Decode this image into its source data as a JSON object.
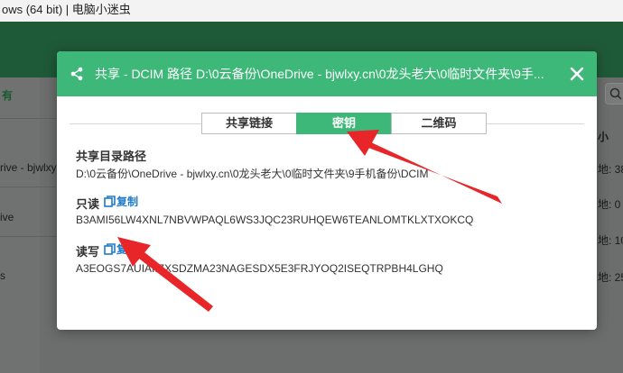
{
  "window": {
    "title": "ows (64 bit) | 电脑小迷虫"
  },
  "background": {
    "col_header": "有",
    "row1": "rive - bjwlxy",
    "row2": "ive",
    "row3": "s",
    "right_header": "小",
    "right_rows": [
      "地: 38",
      "地: 0",
      "地: 10",
      "地: 25"
    ]
  },
  "dialog": {
    "title": "共享 - DCIM 路径 D:\\0云备份\\OneDrive - bjwlxy.cn\\0龙头老大\\0临时文件夹\\9手...",
    "tabs": [
      "共享链接",
      "密钥",
      "二维码"
    ],
    "active_tab": 1,
    "path_label": "共享目录路径",
    "path_value": "D:\\0云备份\\OneDrive - bjwlxy.cn\\0龙头老大\\0临时文件夹\\9手机备份\\DCIM",
    "readonly_label": "只读",
    "readonly_key": "B3AMI56LW4XNL7NBVWPAQL6WS3JQC23RUHQEW6TEANLOMTKLXTXOKCQ",
    "readwrite_label": "读写",
    "readwrite_key": "A3EOGS7AUIAIIZXSDZMA23NAGESDX5E3FRJYOQ2ISEQTRPBH4LGHQ",
    "copy_label": "复制"
  },
  "colors": {
    "accent": "#3eb878",
    "link": "#1e7bc9",
    "annotation": "#e8262a"
  }
}
